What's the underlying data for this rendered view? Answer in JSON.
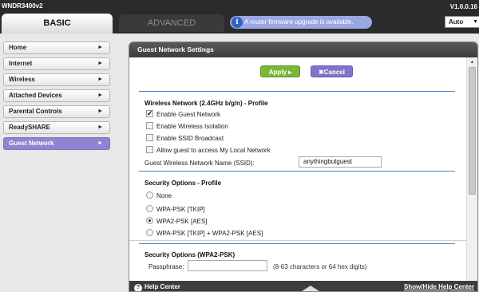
{
  "header": {
    "model": "WNDR3400v2",
    "version": "V1.0.0.16",
    "tabs": [
      {
        "label": "BASIC",
        "active": true
      },
      {
        "label": "ADVANCED",
        "active": false
      }
    ],
    "firmware_notice": "A router firmware upgrade is available.",
    "language": "Auto"
  },
  "sidebar": {
    "items": [
      {
        "label": "Home"
      },
      {
        "label": "Internet"
      },
      {
        "label": "Wireless"
      },
      {
        "label": "Attached Devices"
      },
      {
        "label": "Parental Controls"
      },
      {
        "label": "ReadySHARE"
      },
      {
        "label": "Guest Network",
        "active": true
      }
    ]
  },
  "panel": {
    "title": "Guest Network Settings",
    "apply_label": "Apply ▸",
    "cancel_label": "✖Cancel",
    "profile": {
      "title": "Wireless Network (2.4GHz b/g/n) - Profile",
      "options": [
        {
          "label": "Enable Guest Network",
          "checked": true
        },
        {
          "label": "Enable Wireless Isolation",
          "checked": false
        },
        {
          "label": "Enable SSID Broadcast",
          "checked": false
        },
        {
          "label": "Allow guest to access My Local Network",
          "checked": false
        }
      ],
      "ssid_label": "Guest Wireless Network Name (SSID):",
      "ssid_value": "anythingbutguest"
    },
    "security": {
      "title": "Security Options - Profile",
      "options": [
        {
          "label": "None",
          "selected": false
        },
        {
          "label": "WPA-PSK [TKIP]",
          "selected": false
        },
        {
          "label": "WPA2-PSK [AES]",
          "selected": true
        },
        {
          "label": "WPA-PSK [TKIP] + WPA2-PSK [AES]",
          "selected": false
        }
      ]
    },
    "wpa2": {
      "title": "Security Options (WPA2-PSK)",
      "passphrase_label": "Passphrase:",
      "passphrase_value": "",
      "passphrase_hint": "(8-63 characters or 64 hex digits)"
    }
  },
  "helpbar": {
    "help_center": "Help Center",
    "toggle": "Show/Hide Help Center"
  },
  "colors": {
    "active_nav": "#8e84d1",
    "apply": "#79b937",
    "cancel": "#7f74c7",
    "divider": "#3b87c7"
  }
}
